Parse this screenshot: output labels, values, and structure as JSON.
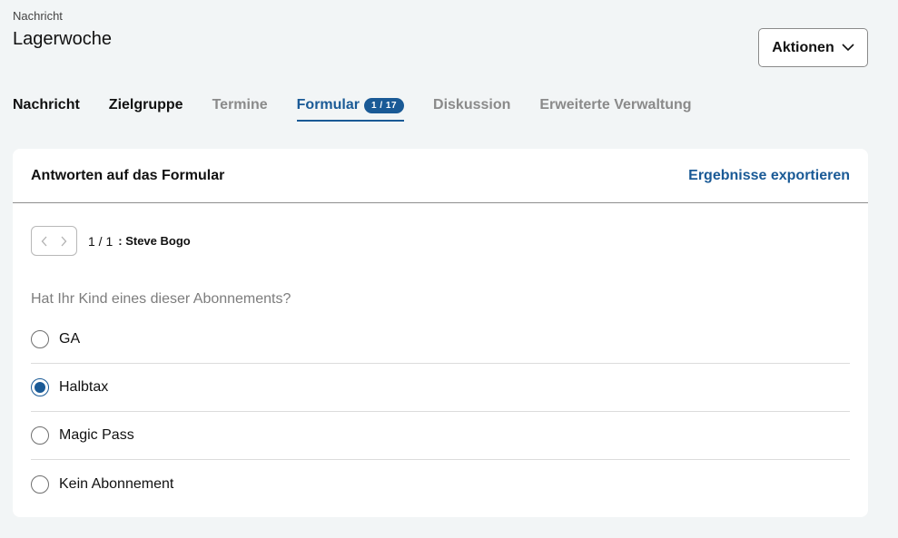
{
  "header": {
    "breadcrumb": "Nachricht",
    "title": "Lagerwoche",
    "actions_label": "Aktionen"
  },
  "tabs": [
    {
      "label": "Nachricht",
      "state": "dark"
    },
    {
      "label": "Zielgruppe",
      "state": "dark"
    },
    {
      "label": "Termine",
      "state": "muted"
    },
    {
      "label": "Formular",
      "state": "active",
      "badge": "1 / 17"
    },
    {
      "label": "Diskussion",
      "state": "muted"
    },
    {
      "label": "Erweiterte Verwaltung",
      "state": "muted"
    }
  ],
  "card": {
    "title": "Antworten auf das Formular",
    "export_label": "Ergebnisse exportieren",
    "pager": {
      "count": "1 / 1",
      "name": ": Steve Bogo"
    },
    "question": "Hat Ihr Kind eines dieser Abonnements?",
    "options": [
      {
        "label": "GA",
        "selected": false
      },
      {
        "label": "Halbtax",
        "selected": true
      },
      {
        "label": "Magic Pass",
        "selected": false
      },
      {
        "label": "Kein Abonnement",
        "selected": false
      }
    ]
  },
  "colors": {
    "accent": "#1a5a96",
    "background": "#f2f5f6",
    "muted_text": "#8a8a8a"
  },
  "icons": {
    "actions": "chevron-down-icon",
    "pager_prev": "chevron-left-icon",
    "pager_next": "chevron-right-icon"
  }
}
